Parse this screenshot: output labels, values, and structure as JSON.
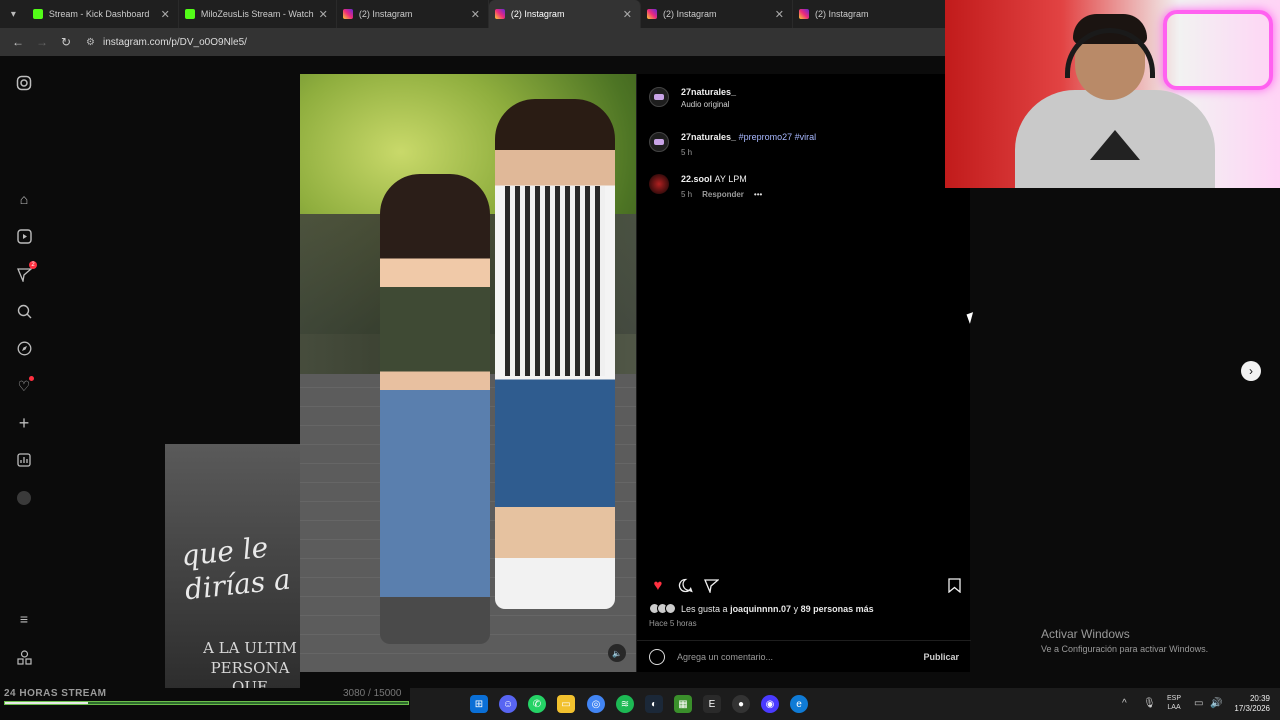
{
  "browser": {
    "tabs": [
      {
        "title": "Stream - Kick Dashboard",
        "favicon": "kick",
        "active": false
      },
      {
        "title": "MiloZeusLis Stream - Watch Live",
        "favicon": "kick",
        "active": false
      },
      {
        "title": "(2) Instagram",
        "favicon": "instagram",
        "active": false
      },
      {
        "title": "(2) Instagram",
        "favicon": "instagram",
        "active": true
      },
      {
        "title": "(2) Instagram",
        "favicon": "instagram",
        "active": false
      },
      {
        "title": "(2) Instagram",
        "favicon": "instagram",
        "active": false
      }
    ],
    "url": "instagram.com/p/DV_o0O9Nle5/"
  },
  "sidebar": {
    "icons": [
      "instagram-logo-icon",
      "home-icon",
      "reels-icon",
      "messages-icon",
      "search-icon",
      "explore-icon",
      "notifications-icon",
      "create-icon",
      "dashboard-icon",
      "profile-icon",
      "menu-icon",
      "more-apps-icon"
    ],
    "messages_badge": "2"
  },
  "thumbnail": {
    "script_line1": "que le",
    "script_line2": "dirías a",
    "caps_line1": "A LA ULTIM",
    "caps_line2": "PERSONA",
    "caps_line3": "QUE BESASTE?"
  },
  "post": {
    "author": "27naturales_",
    "audio": "Audio original",
    "caption": {
      "user": "27naturales_",
      "tags": "#prepromo27 #viral",
      "time": "5 h"
    },
    "comments": [
      {
        "user": "22.sool",
        "text": "AY LPM",
        "time": "5 h",
        "reply_label": "Responder",
        "more": "•••"
      }
    ],
    "liked": true,
    "likes_prefix": "Les gusta a",
    "likes_user": "joaquinnnn.07",
    "likes_mid": "y",
    "likes_others": "89 personas más",
    "timestamp": "Hace 5 horas",
    "comment_placeholder": "Agrega un comentario...",
    "publish_label": "Publicar"
  },
  "overlay": {
    "windows_title": "Activar Windows",
    "windows_sub": "Ve a Configuración para activar Windows.",
    "stream_label": "24 HORAS STREAM",
    "stream_count": "3080 / 15000",
    "stream_progress": 0.2053
  },
  "taskbar": {
    "lang_line1": "ESP",
    "lang_line2": "LAA",
    "time": "20:39",
    "date": "17/3/2026"
  },
  "colors": {
    "like_red": "#ff3040",
    "hashtag": "#a8b8ff",
    "progress_green": "#2d6a2d"
  }
}
